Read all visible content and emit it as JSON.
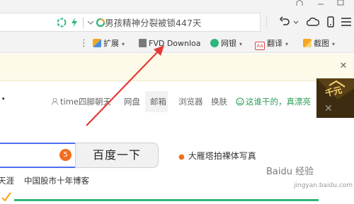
{
  "address_bar": {
    "search_text": "男孩精神分裂被锁447天"
  },
  "bookmarks": {
    "items": [
      {
        "label": "扩展"
      },
      {
        "label": "FVD Downloa"
      },
      {
        "label": "网银"
      },
      {
        "label": "翻译"
      },
      {
        "label": "截图"
      }
    ]
  },
  "page": {
    "nav": {
      "user": "time四脚朝天",
      "links": [
        "网盘",
        "邮箱",
        "浏览器",
        "换肤"
      ],
      "promo": "这谁干的，真漂亮"
    },
    "search_button": "百度一下",
    "badge": "5",
    "hot_item": "大雁塔拍裸体写真",
    "news": [
      "天涯",
      "中国股市十年博客"
    ]
  },
  "ad": {
    "text": "千元"
  },
  "watermark": {
    "text": "Baidu 经验",
    "sub": "jingyan.baidu.com"
  },
  "colors": {
    "search_border": "#4e6ef2",
    "badge": "#f56c1f",
    "arrow": "#e53935",
    "promo": "#2a9d57"
  }
}
